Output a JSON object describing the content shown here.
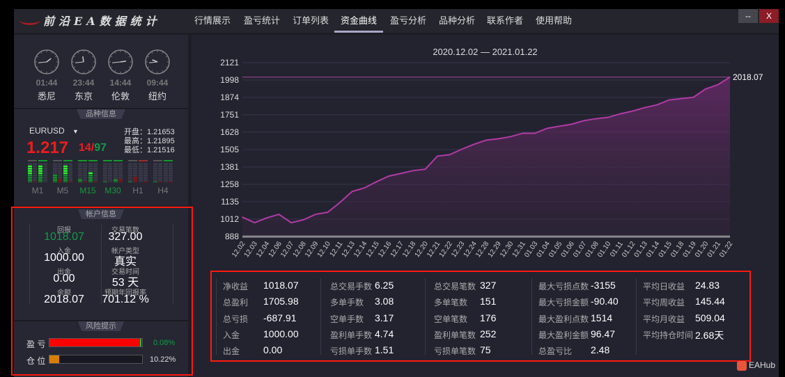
{
  "app": {
    "title": "前沿EA数据统计",
    "minimize": "--",
    "close": "X"
  },
  "tabs": [
    {
      "label": "行情展示"
    },
    {
      "label": "盈亏统计"
    },
    {
      "label": "订单列表"
    },
    {
      "label": "资金曲线",
      "active": true
    },
    {
      "label": "盈亏分析"
    },
    {
      "label": "品种分析"
    },
    {
      "label": "联系作者"
    },
    {
      "label": "使用帮助"
    }
  ],
  "clocks": [
    {
      "time": "01:44",
      "city": "悉尼",
      "h": 1,
      "m": 44
    },
    {
      "time": "23:44",
      "city": "东京",
      "h": 23,
      "m": 44
    },
    {
      "time": "14:44",
      "city": "伦敦",
      "h": 14,
      "m": 44
    },
    {
      "time": "09:44",
      "city": "纽约",
      "h": 9,
      "m": 44
    }
  ],
  "symbol_info": {
    "section": "品种信息",
    "symbol": "EURUSD",
    "price_main": "1.217",
    "price_bid": "14",
    "sep": "/",
    "price_ask": "97",
    "open_label": "开盘：",
    "open": "1.21653",
    "high_label": "最高：",
    "high": "1.21895",
    "low_label": "最低：",
    "low": "1.21516",
    "timeframes": [
      {
        "label": "M1",
        "green": false
      },
      {
        "label": "M5",
        "green": false
      },
      {
        "label": "M15",
        "green": true
      },
      {
        "label": "M30",
        "green": true
      },
      {
        "label": "H1",
        "green": false
      },
      {
        "label": "H4",
        "green": false
      }
    ]
  },
  "account": {
    "section": "帐户信息",
    "left": [
      {
        "label": "回报",
        "value": "1018.07",
        "color": "#139a47"
      },
      {
        "label": "入金",
        "value": "1000.00"
      },
      {
        "label": "出金",
        "value": "0.00"
      },
      {
        "label": "余额",
        "value": "2018.07"
      }
    ],
    "right": [
      {
        "label": "交易笔数",
        "value": "327.00"
      },
      {
        "label": "帐户类型",
        "value": "真实"
      },
      {
        "label": "交易时间",
        "value": "53 天"
      },
      {
        "label": "预期年回报率",
        "value": "701.12 %"
      }
    ]
  },
  "risk": {
    "section": "风险提示",
    "pl_label": "盈 亏",
    "pl_pct": "0.08%",
    "pl_fill": 0.99,
    "pos_label": "仓 位",
    "pos_pct": "10.22%",
    "pos_fill": 0.1022,
    "colors": {
      "pl": "#ff0000",
      "pos": "#d97f00",
      "green": "#139a47"
    }
  },
  "stats": [
    [
      {
        "l": "净收益",
        "v": "1018.07"
      },
      {
        "l": "总盈利",
        "v": "1705.98"
      },
      {
        "l": "总亏损",
        "v": "-687.91"
      },
      {
        "l": "入金",
        "v": "1000.00"
      },
      {
        "l": "出金",
        "v": "0.00"
      }
    ],
    [
      {
        "l": "总交易手数",
        "v": "6.25"
      },
      {
        "l": "多单手数",
        "v": "3.08"
      },
      {
        "l": "空单手数",
        "v": "3.17"
      },
      {
        "l": "盈利单手数",
        "v": "4.74"
      },
      {
        "l": "亏损单手数",
        "v": "1.51"
      }
    ],
    [
      {
        "l": "总交易笔数",
        "v": "327"
      },
      {
        "l": "多单笔数",
        "v": "151"
      },
      {
        "l": "空单笔数",
        "v": "176"
      },
      {
        "l": "盈利单笔数",
        "v": "252"
      },
      {
        "l": "亏损单笔数",
        "v": "75"
      }
    ],
    [
      {
        "l": "最大亏损点数",
        "v": "-3155"
      },
      {
        "l": "最大亏损金额",
        "v": "-90.40"
      },
      {
        "l": "最大盈利点数",
        "v": "1514"
      },
      {
        "l": "最大盈利金额",
        "v": "96.47"
      },
      {
        "l": "总盈亏比",
        "v": "2.48"
      }
    ],
    [
      {
        "l": "平均日收益",
        "v": "24.83"
      },
      {
        "l": "平均周收益",
        "v": "145.44"
      },
      {
        "l": "平均月收益",
        "v": "509.04"
      },
      {
        "l": "平均持仓时间",
        "v": "2.68天"
      }
    ]
  ],
  "chart_data": {
    "type": "area",
    "title": "2020.12.02 — 2021.01.22",
    "ylim": [
      888,
      2121
    ],
    "yticks": [
      "2121",
      "1998",
      "1874",
      "1751",
      "1628",
      "1505",
      "1381",
      "1258",
      "1135",
      "1012",
      "888"
    ],
    "categories": [
      "12.02",
      "12.03",
      "12.04",
      "12.06",
      "12.07",
      "12.08",
      "12.09",
      "12.10",
      "12.11",
      "12.13",
      "12.14",
      "12.15",
      "12.16",
      "12.17",
      "12.18",
      "12.20",
      "12.21",
      "12.22",
      "12.23",
      "12.24",
      "12.28",
      "12.29",
      "12.30",
      "12.31",
      "01.03",
      "01.04",
      "01.05",
      "01.06",
      "01.07",
      "01.08",
      "01.10",
      "01.11",
      "01.12",
      "01.13",
      "01.14",
      "01.15",
      "01.18",
      "01.19",
      "01.20",
      "01.21",
      "01.22"
    ],
    "values": [
      1025,
      986,
      1020,
      1045,
      986,
      1006,
      1045,
      1060,
      1129,
      1207,
      1232,
      1276,
      1316,
      1335,
      1355,
      1365,
      1458,
      1468,
      1507,
      1542,
      1571,
      1581,
      1596,
      1620,
      1620,
      1655,
      1670,
      1684,
      1709,
      1723,
      1733,
      1758,
      1777,
      1802,
      1821,
      1856,
      1866,
      1875,
      1934,
      1964,
      2018.07
    ],
    "reference_line": 2018.07,
    "end_label": "2018.07",
    "line_color": "#b23aa6"
  },
  "watermark": "EAHub"
}
